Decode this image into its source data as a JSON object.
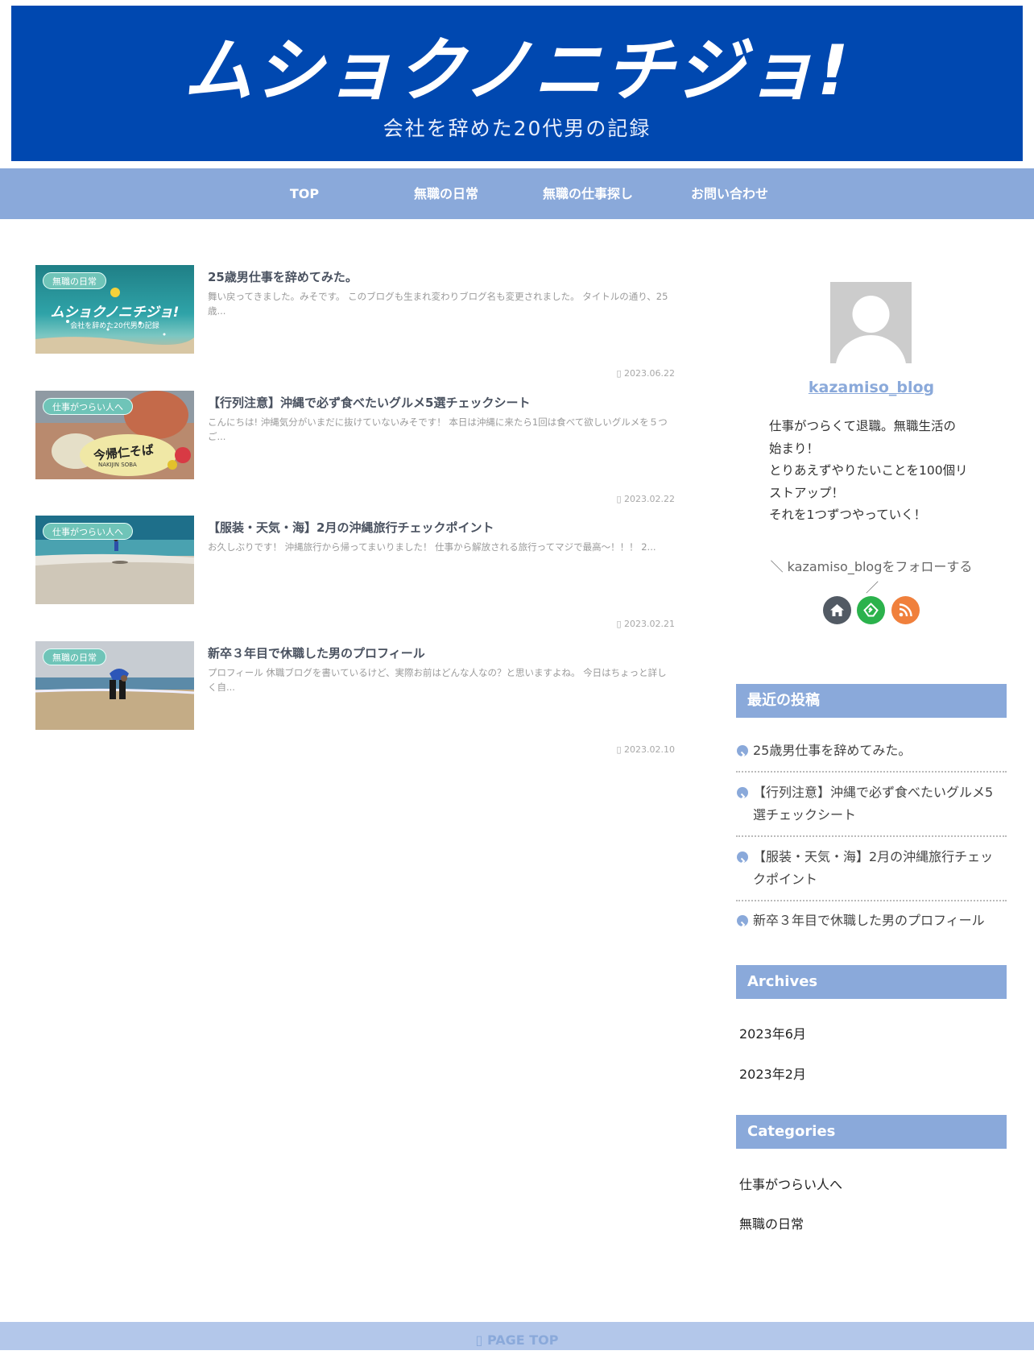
{
  "header": {
    "logo": "ムショクノニチジョ!",
    "tagline": "会社を辞めた20代男の記録"
  },
  "nav": {
    "items": [
      {
        "label": "TOP"
      },
      {
        "label": "無職の日常"
      },
      {
        "label": "無職の仕事探し"
      },
      {
        "label": "お問い合わせ"
      }
    ]
  },
  "posts": [
    {
      "category": "無職の日常",
      "title": "25歳男仕事を辞めてみた。",
      "excerpt": "舞い戻ってきました。みそです。 このブログも生まれ変わりブログ名も変更されました。 タイトルの通り、25歳...",
      "date": "2023.06.22",
      "thumb_logo": "ムショクノニチジョ!",
      "thumb_sub": "会社を辞めた20代男の記録"
    },
    {
      "category": "仕事がつらい人へ",
      "title": "【行列注意】沖縄で必ず食べたいグルメ5選チェックシート",
      "excerpt": "こんにちは! 沖縄気分がいまだに抜けていないみそです！ 本日は沖縄に来たら1回は食べて欲しいグルメを５つご...",
      "date": "2023.02.22",
      "thumb_sign": "今帰仁そば",
      "thumb_sign_en": "NAKIJIN SOBA"
    },
    {
      "category": "仕事がつらい人へ",
      "title": "【服装・天気・海】2月の沖縄旅行チェックポイント",
      "excerpt": "お久しぶりです！ 沖縄旅行から帰ってまいりました！ 仕事から解放される旅行ってマジで最高〜！！！ 2...",
      "date": "2023.02.21"
    },
    {
      "category": "無職の日常",
      "title": "新卒３年目で休職した男のプロフィール",
      "excerpt": "プロフィール 休職ブログを書いているけど、実際お前はどんな人なの？と思いますよね。 今日はちょっと詳しく自...",
      "date": "2023.02.10"
    }
  ],
  "sidebar": {
    "author_name": "kazamiso_blog",
    "bio_lines": [
      "仕事がつらくて退職。無職生活の",
      "始まり！",
      "とりあえずやりたいことを100個リ",
      "ストアップ！",
      "それを1つずつやっていく！"
    ],
    "follow_text": "＼ kazamiso_blogをフォローする",
    "follow_slash": "／",
    "social": [
      {
        "icon": "home-icon",
        "color": "#525a64"
      },
      {
        "icon": "feedly-icon",
        "color": "#2bb24c"
      },
      {
        "icon": "rss-icon",
        "color": "#f0803c"
      }
    ],
    "recent_title": "最近の投稿",
    "recent": [
      {
        "lines": [
          "25歳男仕事を辞めてみた。"
        ]
      },
      {
        "lines": [
          "【行列注意】沖縄で必ず食べたいグルメ5",
          "選チェックシート"
        ]
      },
      {
        "lines": [
          "【服装・天気・海】2月の沖縄旅行チェッ",
          "クポイント"
        ]
      },
      {
        "lines": [
          "新卒３年目で休職した男のプロフィール"
        ]
      }
    ],
    "archives_title": "Archives",
    "archives": [
      "2023年6月",
      "2023年2月"
    ],
    "categories_title": "Categories",
    "categories": [
      "仕事がつらい人へ",
      "無職の日常"
    ]
  },
  "footer": {
    "page_top": "PAGE TOP"
  },
  "colors": {
    "header_bg": "#0048b0",
    "accent": "#8aa9da",
    "badge": "#6fc4b8"
  }
}
